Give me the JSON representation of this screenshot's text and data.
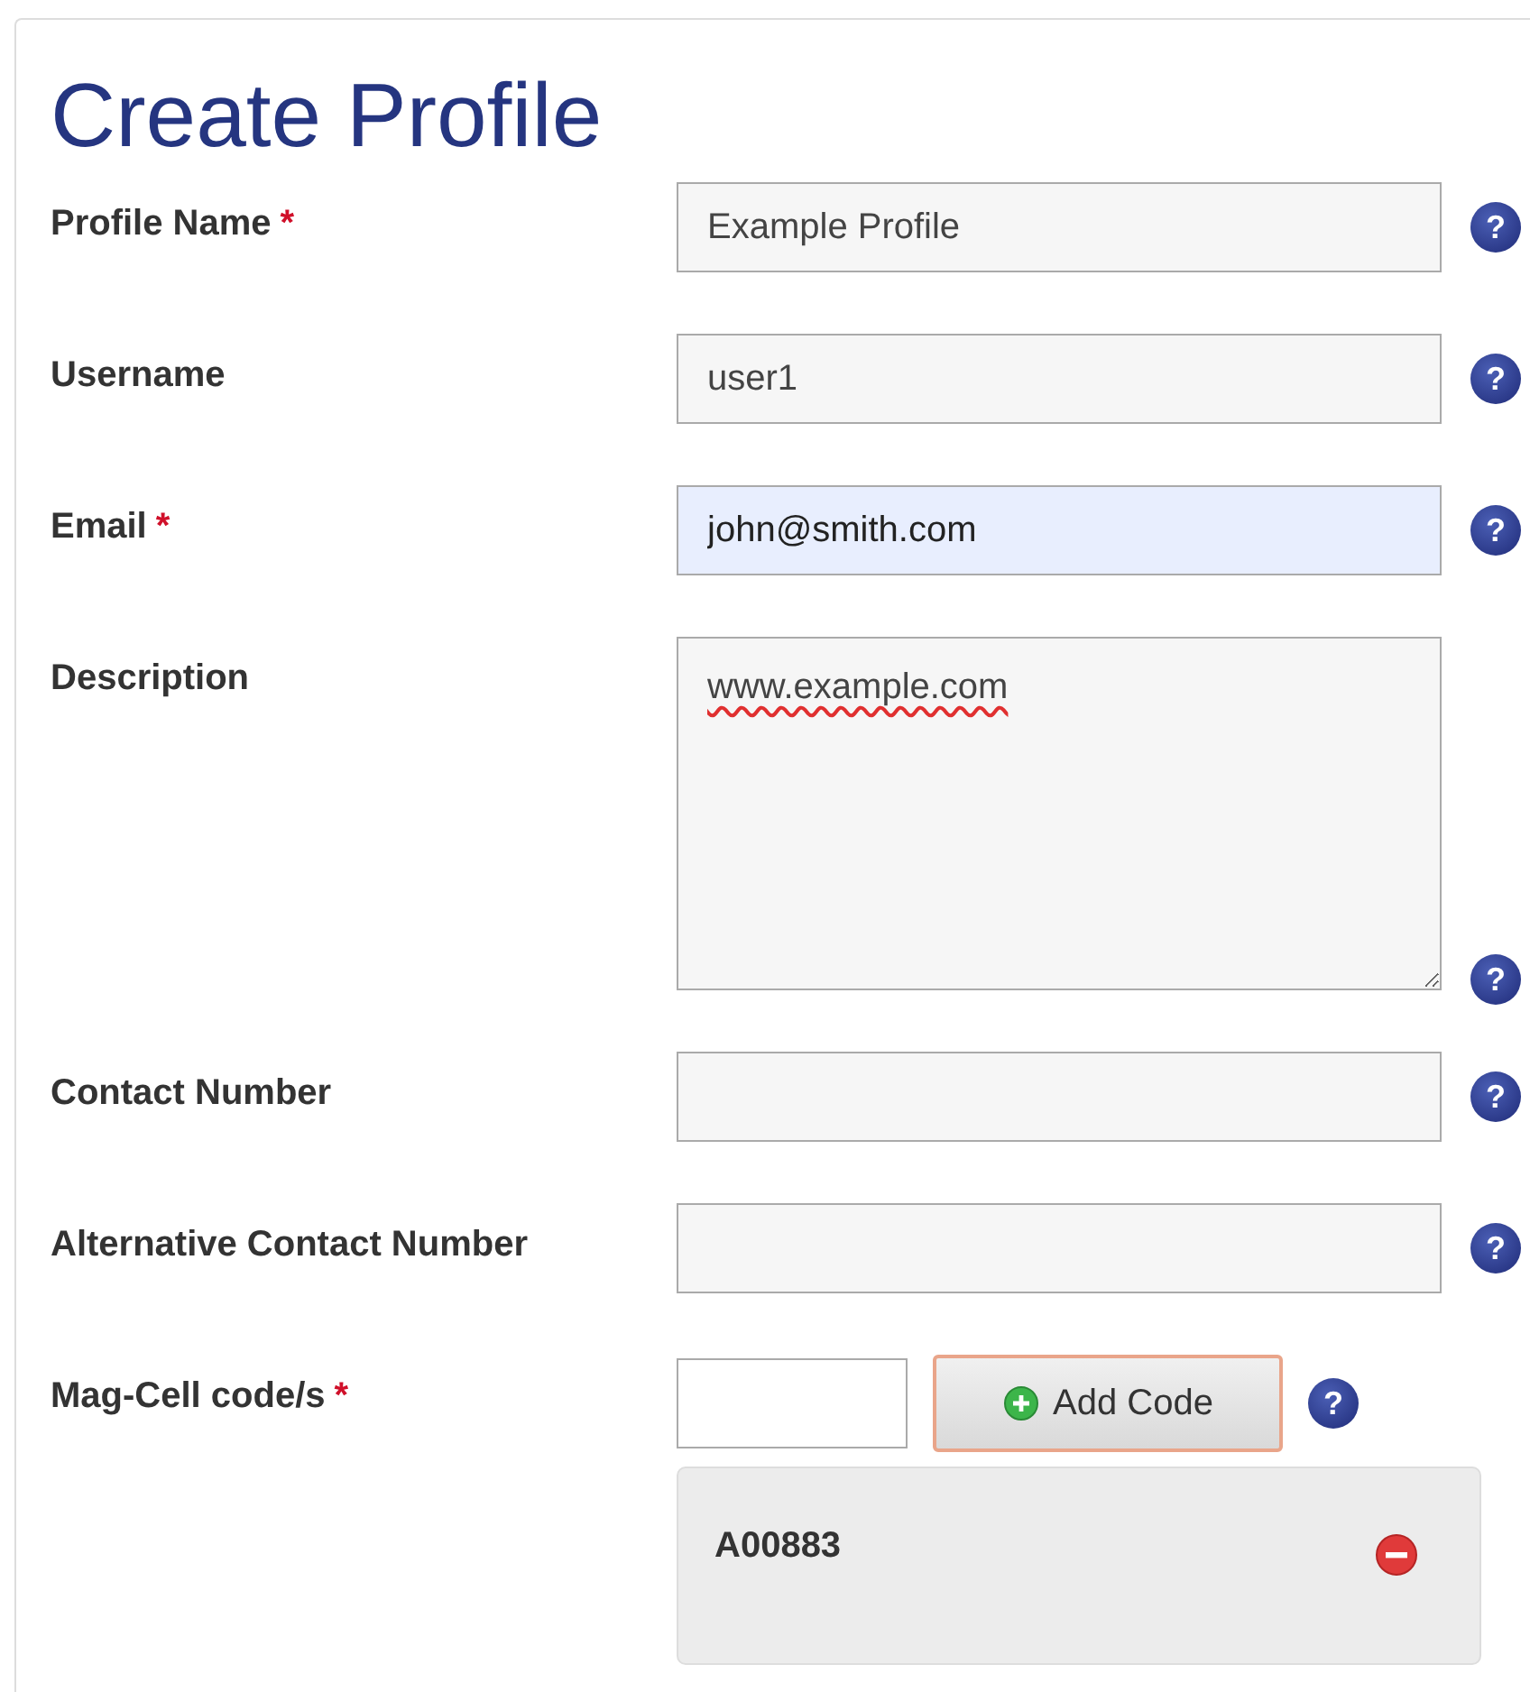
{
  "title": "Create Profile",
  "fields": [
    {
      "kind": "text",
      "label": "Profile Name",
      "required_mark": "*",
      "value": "Example Profile",
      "focused": false
    },
    {
      "kind": "text",
      "label": "Username",
      "value": "user1",
      "focused": false
    },
    {
      "kind": "text",
      "label": "Email",
      "required_mark": "*",
      "value": "john@smith.com",
      "focused": true
    },
    {
      "kind": "textarea",
      "label": "Description",
      "value": "www.example.com",
      "focused": false
    },
    {
      "kind": "text",
      "label": "Contact Number",
      "focused": false
    },
    {
      "kind": "text",
      "label": "Alternative Contact Number",
      "focused": false
    },
    {
      "kind": "code",
      "label": "Mag-Cell code/s",
      "required_mark": "*",
      "focused": false,
      "button": "Add Code",
      "codes": [
        "A00883"
      ]
    }
  ],
  "help_glyph": "?"
}
